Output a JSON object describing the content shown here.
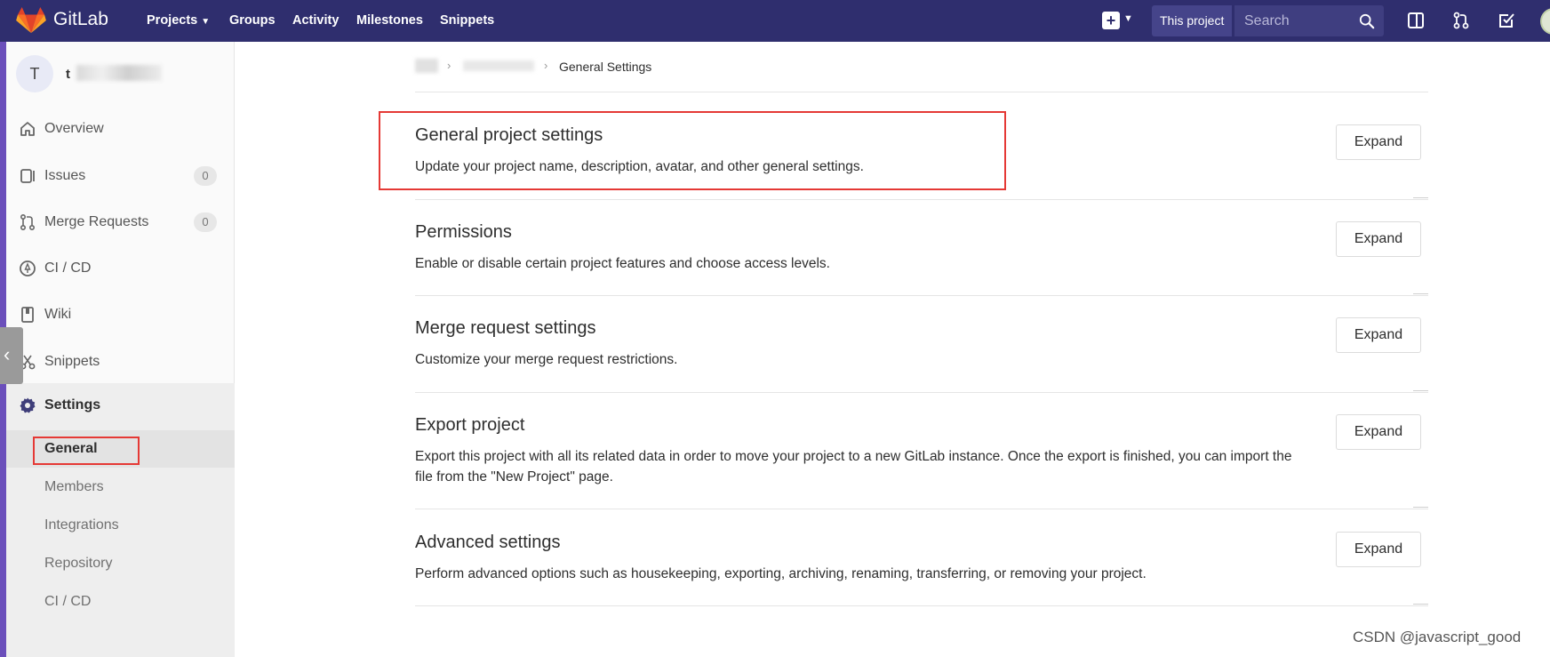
{
  "navbar": {
    "brand": "GitLab",
    "links": [
      {
        "label": "Projects",
        "dropdown": true
      },
      {
        "label": "Groups"
      },
      {
        "label": "Activity"
      },
      {
        "label": "Milestones"
      },
      {
        "label": "Snippets"
      }
    ],
    "new_menu_icon": "plus-square-icon",
    "search_scope": "This project",
    "search_placeholder": "Search",
    "right_icons": [
      "sidebar-toggle-icon",
      "merge-request-icon",
      "todo-check-icon"
    ],
    "colors": {
      "background": "#2f2e6e",
      "accent": "#fc6d26"
    }
  },
  "sidebar": {
    "project_initial": "T",
    "project_name": "t",
    "items": [
      {
        "label": "Overview",
        "icon": "home-icon"
      },
      {
        "label": "Issues",
        "icon": "issues-icon",
        "count": "0"
      },
      {
        "label": "Merge Requests",
        "icon": "merge-request-icon",
        "count": "0"
      },
      {
        "label": "CI / CD",
        "icon": "rocket-icon"
      },
      {
        "label": "Wiki",
        "icon": "book-icon"
      },
      {
        "label": "Snippets",
        "icon": "scissors-icon"
      },
      {
        "label": "Settings",
        "icon": "gear-icon",
        "active": true
      }
    ],
    "settings_subitems": [
      {
        "label": "General",
        "active": true
      },
      {
        "label": "Members"
      },
      {
        "label": "Integrations"
      },
      {
        "label": "Repository"
      },
      {
        "label": "CI / CD"
      }
    ]
  },
  "breadcrumb": {
    "current": "General Settings"
  },
  "sections": [
    {
      "title": "General project settings",
      "description": "Update your project name, description, avatar, and other general settings.",
      "button": "Expand"
    },
    {
      "title": "Permissions",
      "description": "Enable or disable certain project features and choose access levels.",
      "button": "Expand"
    },
    {
      "title": "Merge request settings",
      "description": "Customize your merge request restrictions.",
      "button": "Expand"
    },
    {
      "title": "Export project",
      "description": "Export this project with all its related data in order to move your project to a new GitLab instance. Once the export is finished, you can import the file from the \"New Project\" page.",
      "button": "Expand"
    },
    {
      "title": "Advanced settings",
      "description": "Perform advanced options such as housekeeping, exporting, archiving, renaming, transferring, or removing your project.",
      "button": "Expand"
    }
  ],
  "watermark": "CSDN @javascript_good",
  "annotation_color": "#e53935"
}
